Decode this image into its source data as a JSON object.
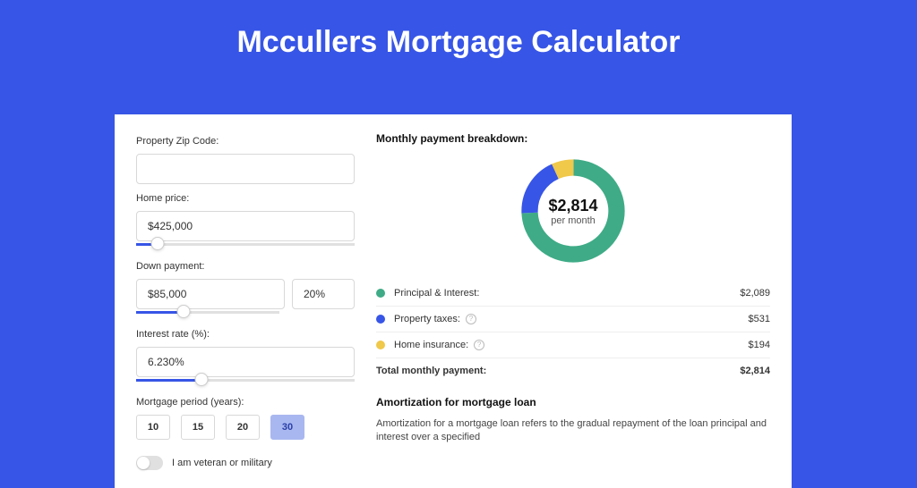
{
  "title": "Mccullers Mortgage Calculator",
  "form": {
    "zip_label": "Property Zip Code:",
    "zip_value": "",
    "home_price_label": "Home price:",
    "home_price_value": "$425,000",
    "home_price_slider_pct": 10,
    "down_payment_label": "Down payment:",
    "down_payment_value": "$85,000",
    "down_payment_pct": "20%",
    "down_payment_slider_pct": 20,
    "interest_label": "Interest rate (%):",
    "interest_value": "6.230%",
    "interest_slider_pct": 30,
    "period_label": "Mortgage period (years):",
    "periods": [
      "10",
      "15",
      "20",
      "30"
    ],
    "period_selected": "30",
    "veteran_label": "I am veteran or military"
  },
  "breakdown": {
    "title": "Monthly payment breakdown:",
    "center_amount": "$2,814",
    "center_sub": "per month",
    "items": [
      {
        "label": "Principal & Interest:",
        "value": "$2,089",
        "color": "#3fab87",
        "help": false
      },
      {
        "label": "Property taxes:",
        "value": "$531",
        "color": "#3755e6",
        "help": true
      },
      {
        "label": "Home insurance:",
        "value": "$194",
        "color": "#f0c84a",
        "help": true
      }
    ],
    "total_label": "Total monthly payment:",
    "total_value": "$2,814"
  },
  "amortization": {
    "title": "Amortization for mortgage loan",
    "text": "Amortization for a mortgage loan refers to the gradual repayment of the loan principal and interest over a specified"
  },
  "chart_data": {
    "type": "pie",
    "title": "Monthly payment breakdown",
    "series": [
      {
        "name": "Principal & Interest",
        "value": 2089,
        "color": "#3fab87"
      },
      {
        "name": "Property taxes",
        "value": 531,
        "color": "#3755e6"
      },
      {
        "name": "Home insurance",
        "value": 194,
        "color": "#f0c84a"
      }
    ],
    "total": 2814,
    "unit": "USD/month"
  }
}
